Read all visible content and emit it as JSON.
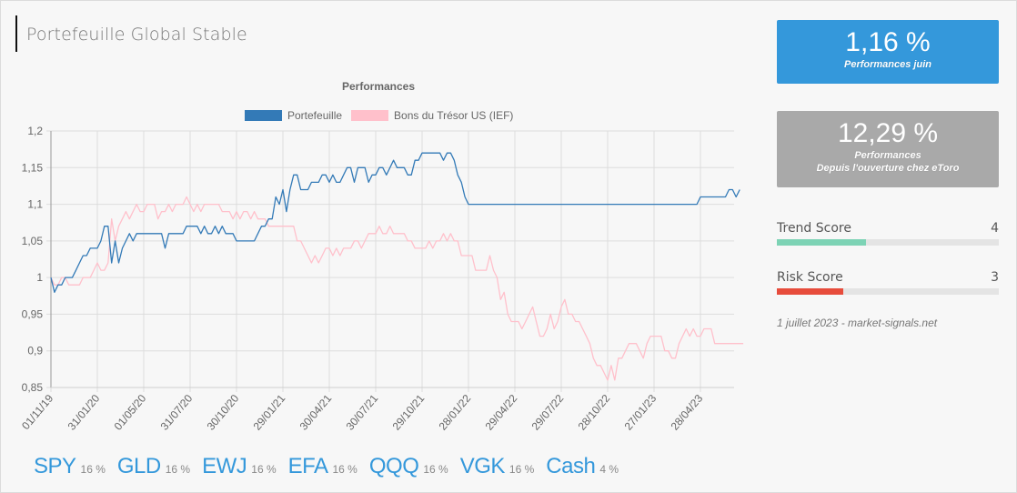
{
  "page": {
    "title": "Portefeuille Global Stable"
  },
  "cards": [
    {
      "value": "1,16 %",
      "label": "Performances juin",
      "color": "#3498db"
    },
    {
      "value": "12,29 %",
      "label_line1": "Performances",
      "label_line2": "Depuis l'ouverture chez eToro",
      "color": "#a9a9a9"
    }
  ],
  "scores": [
    {
      "label": "Trend Score",
      "value": "4",
      "fraction": 0.4,
      "color": "#7dd3b5"
    },
    {
      "label": "Risk Score",
      "value": "3",
      "fraction": 0.3,
      "color": "#e74c3c"
    }
  ],
  "footnote": "1 juillet 2023 - market-signals.net",
  "allocations": [
    {
      "symbol": "SPY",
      "weight": "16 %"
    },
    {
      "symbol": "GLD",
      "weight": "16 %"
    },
    {
      "symbol": "EWJ",
      "weight": "16 %"
    },
    {
      "symbol": "EFA",
      "weight": "16 %"
    },
    {
      "symbol": "QQQ",
      "weight": "16 %"
    },
    {
      "symbol": "VGK",
      "weight": "16 %"
    },
    {
      "symbol": "Cash",
      "weight": "4 %"
    }
  ],
  "chart_data": {
    "type": "line",
    "title": "Performances",
    "xlabel": "",
    "ylabel": "",
    "ylim": [
      0.85,
      1.2
    ],
    "yticks": [
      "1,2",
      "1,15",
      "1,1",
      "1,05",
      "1",
      "0,95",
      "0,9",
      "0,85"
    ],
    "ytick_values": [
      1.2,
      1.15,
      1.1,
      1.05,
      1.0,
      0.95,
      0.9,
      0.85
    ],
    "xticks": [
      "01/11/19",
      "31/01/20",
      "01/05/20",
      "31/07/20",
      "30/10/20",
      "29/01/21",
      "30/04/21",
      "30/07/21",
      "29/10/21",
      "28/01/22",
      "29/04/22",
      "29/07/22",
      "28/10/22",
      "27/01/23",
      "28/04/23"
    ],
    "x_frequency": "weekly",
    "points_per_tick": 13,
    "grid": true,
    "legend_position": "top-center",
    "series": [
      {
        "name": "Portefeuille",
        "color": "#337ab7",
        "values": [
          1.0,
          0.98,
          0.99,
          0.99,
          1.0,
          1.0,
          1.0,
          1.01,
          1.02,
          1.03,
          1.03,
          1.04,
          1.04,
          1.04,
          1.05,
          1.07,
          1.07,
          1.02,
          1.05,
          1.02,
          1.04,
          1.05,
          1.06,
          1.05,
          1.06,
          1.06,
          1.06,
          1.06,
          1.06,
          1.06,
          1.06,
          1.06,
          1.04,
          1.06,
          1.06,
          1.06,
          1.06,
          1.06,
          1.07,
          1.07,
          1.07,
          1.07,
          1.06,
          1.07,
          1.06,
          1.06,
          1.07,
          1.06,
          1.07,
          1.06,
          1.06,
          1.06,
          1.05,
          1.05,
          1.05,
          1.05,
          1.05,
          1.05,
          1.06,
          1.07,
          1.07,
          1.08,
          1.08,
          1.11,
          1.1,
          1.12,
          1.09,
          1.12,
          1.14,
          1.14,
          1.12,
          1.12,
          1.12,
          1.13,
          1.13,
          1.13,
          1.14,
          1.14,
          1.13,
          1.14,
          1.13,
          1.13,
          1.14,
          1.15,
          1.15,
          1.13,
          1.15,
          1.15,
          1.15,
          1.13,
          1.14,
          1.14,
          1.15,
          1.15,
          1.14,
          1.15,
          1.16,
          1.15,
          1.15,
          1.15,
          1.14,
          1.14,
          1.16,
          1.16,
          1.17,
          1.17,
          1.17,
          1.17,
          1.17,
          1.17,
          1.16,
          1.17,
          1.17,
          1.16,
          1.14,
          1.13,
          1.11,
          1.1,
          1.1,
          1.1,
          1.1,
          1.1,
          1.1,
          1.1,
          1.1,
          1.1,
          1.1,
          1.1,
          1.1,
          1.1,
          1.1,
          1.1,
          1.1,
          1.1,
          1.1,
          1.1,
          1.1,
          1.1,
          1.1,
          1.1,
          1.1,
          1.1,
          1.1,
          1.1,
          1.1,
          1.1,
          1.1,
          1.1,
          1.1,
          1.1,
          1.1,
          1.1,
          1.1,
          1.1,
          1.1,
          1.1,
          1.1,
          1.1,
          1.1,
          1.1,
          1.1,
          1.1,
          1.1,
          1.1,
          1.1,
          1.1,
          1.1,
          1.1,
          1.1,
          1.1,
          1.1,
          1.1,
          1.1,
          1.1,
          1.1,
          1.1,
          1.1,
          1.1,
          1.1,
          1.1,
          1.1,
          1.1,
          1.11,
          1.11,
          1.11,
          1.11,
          1.11,
          1.11,
          1.11,
          1.11,
          1.12,
          1.12,
          1.11,
          1.12
        ]
      },
      {
        "name": "Bons du Trésor US (IEF)",
        "color": "#ffc0cb",
        "values": [
          1.0,
          0.99,
          0.99,
          1.0,
          1.0,
          0.99,
          0.99,
          0.99,
          0.99,
          1.0,
          1.0,
          1.0,
          1.01,
          1.02,
          1.01,
          1.01,
          1.02,
          1.08,
          1.05,
          1.07,
          1.08,
          1.09,
          1.08,
          1.09,
          1.1,
          1.09,
          1.09,
          1.1,
          1.1,
          1.1,
          1.08,
          1.09,
          1.09,
          1.1,
          1.09,
          1.1,
          1.1,
          1.1,
          1.11,
          1.1,
          1.09,
          1.1,
          1.09,
          1.1,
          1.1,
          1.1,
          1.1,
          1.1,
          1.09,
          1.09,
          1.09,
          1.08,
          1.09,
          1.08,
          1.09,
          1.09,
          1.08,
          1.09,
          1.08,
          1.08,
          1.08,
          1.07,
          1.07,
          1.07,
          1.07,
          1.07,
          1.07,
          1.07,
          1.07,
          1.05,
          1.05,
          1.04,
          1.03,
          1.02,
          1.03,
          1.02,
          1.03,
          1.04,
          1.04,
          1.03,
          1.04,
          1.03,
          1.04,
          1.04,
          1.04,
          1.05,
          1.05,
          1.04,
          1.05,
          1.06,
          1.06,
          1.06,
          1.07,
          1.06,
          1.06,
          1.07,
          1.06,
          1.06,
          1.06,
          1.06,
          1.05,
          1.05,
          1.04,
          1.04,
          1.04,
          1.04,
          1.05,
          1.04,
          1.05,
          1.05,
          1.06,
          1.05,
          1.06,
          1.05,
          1.05,
          1.03,
          1.03,
          1.03,
          1.03,
          1.01,
          1.01,
          1.01,
          1.01,
          1.03,
          1.01,
          1.0,
          0.97,
          0.98,
          0.95,
          0.94,
          0.94,
          0.94,
          0.93,
          0.94,
          0.95,
          0.96,
          0.94,
          0.92,
          0.92,
          0.93,
          0.95,
          0.93,
          0.94,
          0.96,
          0.97,
          0.95,
          0.95,
          0.94,
          0.94,
          0.93,
          0.92,
          0.91,
          0.89,
          0.88,
          0.88,
          0.87,
          0.86,
          0.88,
          0.86,
          0.89,
          0.89,
          0.9,
          0.91,
          0.91,
          0.91,
          0.9,
          0.89,
          0.91,
          0.92,
          0.92,
          0.92,
          0.92,
          0.9,
          0.9,
          0.89,
          0.89,
          0.91,
          0.92,
          0.93,
          0.92,
          0.93,
          0.92,
          0.92,
          0.93,
          0.93,
          0.93,
          0.91,
          0.91,
          0.91,
          0.91,
          0.91,
          0.91,
          0.91,
          0.91,
          0.91
        ]
      }
    ]
  }
}
